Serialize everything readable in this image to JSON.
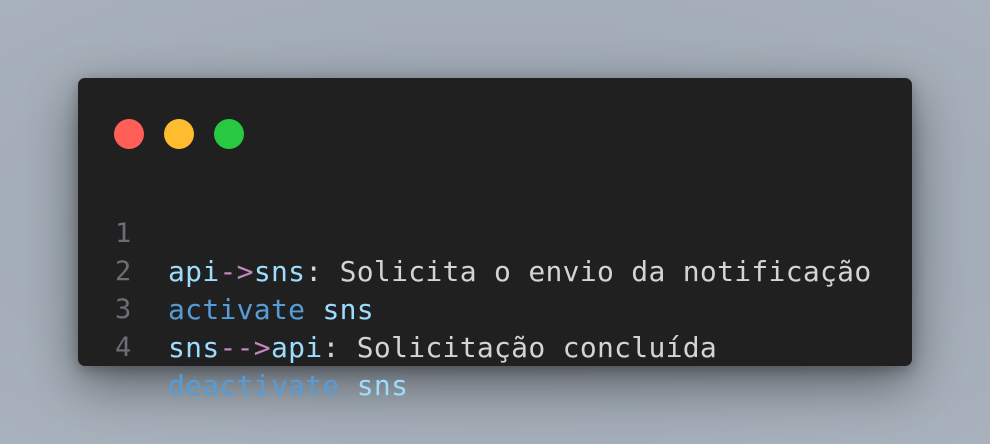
{
  "colors": {
    "page_background": "#a4adb8",
    "window_background": "#202020",
    "dot_red": "#ff5f57",
    "dot_yellow": "#febc2e",
    "dot_green": "#28c840",
    "line_number": "#6b6f75",
    "identifier": "#9cdcfe",
    "arrow": "#c586c0",
    "text": "#d4d4d4",
    "keyword": "#569cd6"
  },
  "window_controls": [
    {
      "name": "close",
      "color": "#ff5f57"
    },
    {
      "name": "minimize",
      "color": "#febc2e"
    },
    {
      "name": "maximize",
      "color": "#28c840"
    }
  ],
  "code": {
    "lines": [
      {
        "number": "1",
        "tokens": [
          {
            "text": "api",
            "kind": "identifier"
          },
          {
            "text": "->",
            "kind": "arrow"
          },
          {
            "text": "sns",
            "kind": "identifier"
          },
          {
            "text": ": Solicita o envio da notificação",
            "kind": "text"
          }
        ]
      },
      {
        "number": "2",
        "tokens": [
          {
            "text": "activate",
            "kind": "keyword"
          },
          {
            "text": " ",
            "kind": "text"
          },
          {
            "text": "sns",
            "kind": "identifier"
          }
        ]
      },
      {
        "number": "3",
        "tokens": [
          {
            "text": "sns",
            "kind": "identifier"
          },
          {
            "text": "-->",
            "kind": "arrow"
          },
          {
            "text": "api",
            "kind": "identifier"
          },
          {
            "text": ": Solicitação concluída",
            "kind": "text"
          }
        ]
      },
      {
        "number": "4",
        "tokens": [
          {
            "text": "deactivate",
            "kind": "keyword"
          },
          {
            "text": " ",
            "kind": "text"
          },
          {
            "text": "sns",
            "kind": "identifier"
          }
        ]
      }
    ]
  }
}
